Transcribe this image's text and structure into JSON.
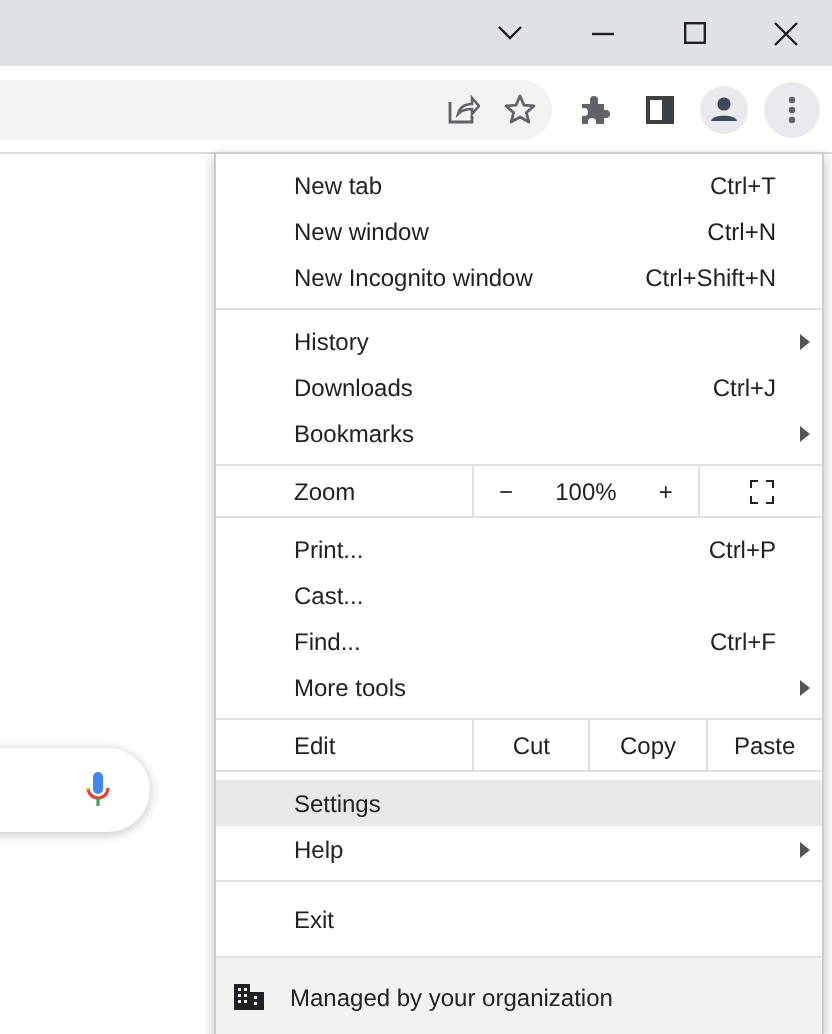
{
  "menu": {
    "sections": [
      {
        "kind": "list",
        "items": [
          {
            "label": "New tab",
            "shortcut": "Ctrl+T",
            "submenu": false,
            "selected": false
          },
          {
            "label": "New window",
            "shortcut": "Ctrl+N",
            "submenu": false,
            "selected": false
          },
          {
            "label": "New Incognito window",
            "shortcut": "Ctrl+Shift+N",
            "submenu": false,
            "selected": false
          }
        ]
      },
      {
        "kind": "list",
        "items": [
          {
            "label": "History",
            "submenu": true,
            "selected": false
          },
          {
            "label": "Downloads",
            "shortcut": "Ctrl+J",
            "submenu": false,
            "selected": false
          },
          {
            "label": "Bookmarks",
            "submenu": true,
            "selected": false
          }
        ]
      },
      {
        "kind": "zoom",
        "label": "Zoom",
        "minus": "−",
        "value": "100%",
        "plus": "+"
      },
      {
        "kind": "list",
        "items": [
          {
            "label": "Print...",
            "shortcut": "Ctrl+P",
            "submenu": false,
            "selected": false
          },
          {
            "label": "Cast...",
            "submenu": false,
            "selected": false
          },
          {
            "label": "Find...",
            "shortcut": "Ctrl+F",
            "submenu": false,
            "selected": false
          },
          {
            "label": "More tools",
            "submenu": true,
            "selected": false
          }
        ]
      },
      {
        "kind": "edit",
        "label": "Edit",
        "buttons": [
          "Cut",
          "Copy",
          "Paste"
        ]
      },
      {
        "kind": "list",
        "items": [
          {
            "label": "Settings",
            "submenu": false,
            "selected": true
          },
          {
            "label": "Help",
            "submenu": true,
            "selected": false
          }
        ]
      },
      {
        "kind": "list",
        "items": [
          {
            "label": "Exit",
            "submenu": false,
            "selected": false
          }
        ]
      }
    ],
    "footer": {
      "label": "Managed by your organization"
    }
  }
}
